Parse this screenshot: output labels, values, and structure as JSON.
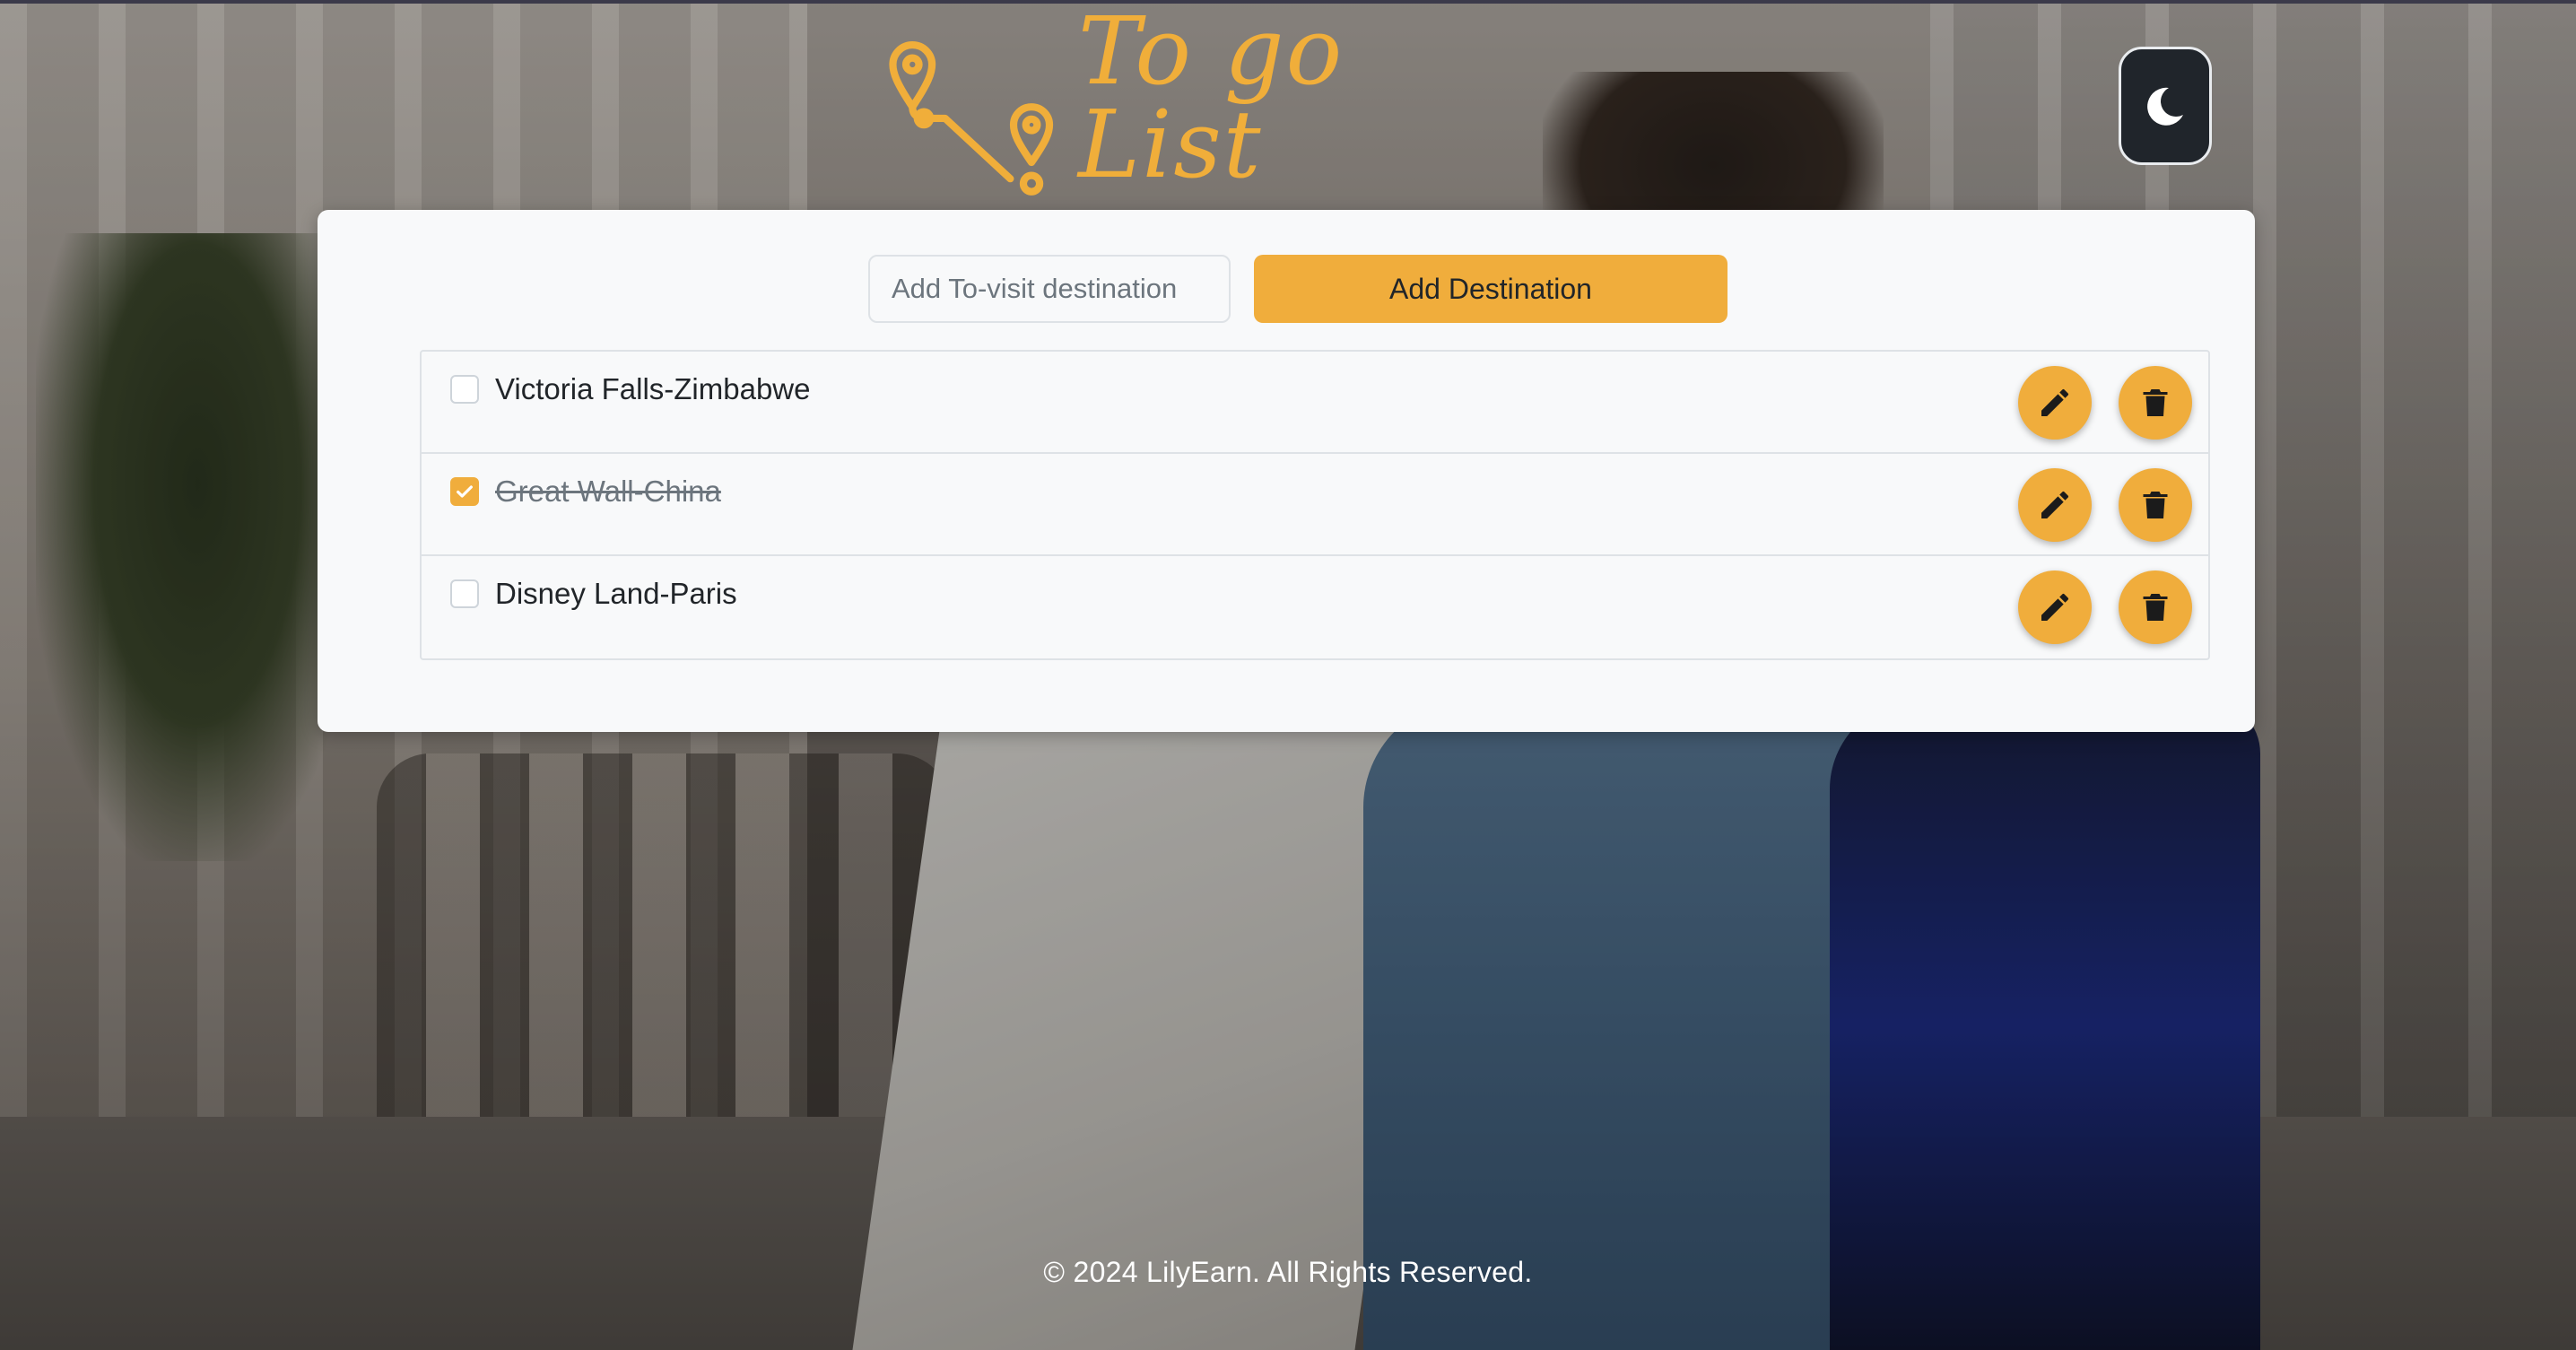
{
  "header": {
    "logo_text": "To go List",
    "logo_icon": "map-route-pins-icon",
    "theme_toggle_icon": "moon-icon"
  },
  "form": {
    "input_placeholder": "Add To-visit destination",
    "input_value": "",
    "add_button_label": "Add Destination"
  },
  "destinations": [
    {
      "label": "Victoria Falls-Zimbabwe",
      "checked": false
    },
    {
      "label": "Great Wall-China",
      "checked": true
    },
    {
      "label": "Disney Land-Paris",
      "checked": false
    }
  ],
  "item_actions": {
    "edit_icon": "pencil-icon",
    "delete_icon": "trash-icon"
  },
  "footer": {
    "text": "© 2024 LilyEarn. All Rights Reserved."
  },
  "colors": {
    "accent": "#f0ad3c",
    "logo": "#f0ae3a",
    "card_bg": "#f8f9fa",
    "toggle_bg": "#20252b"
  }
}
